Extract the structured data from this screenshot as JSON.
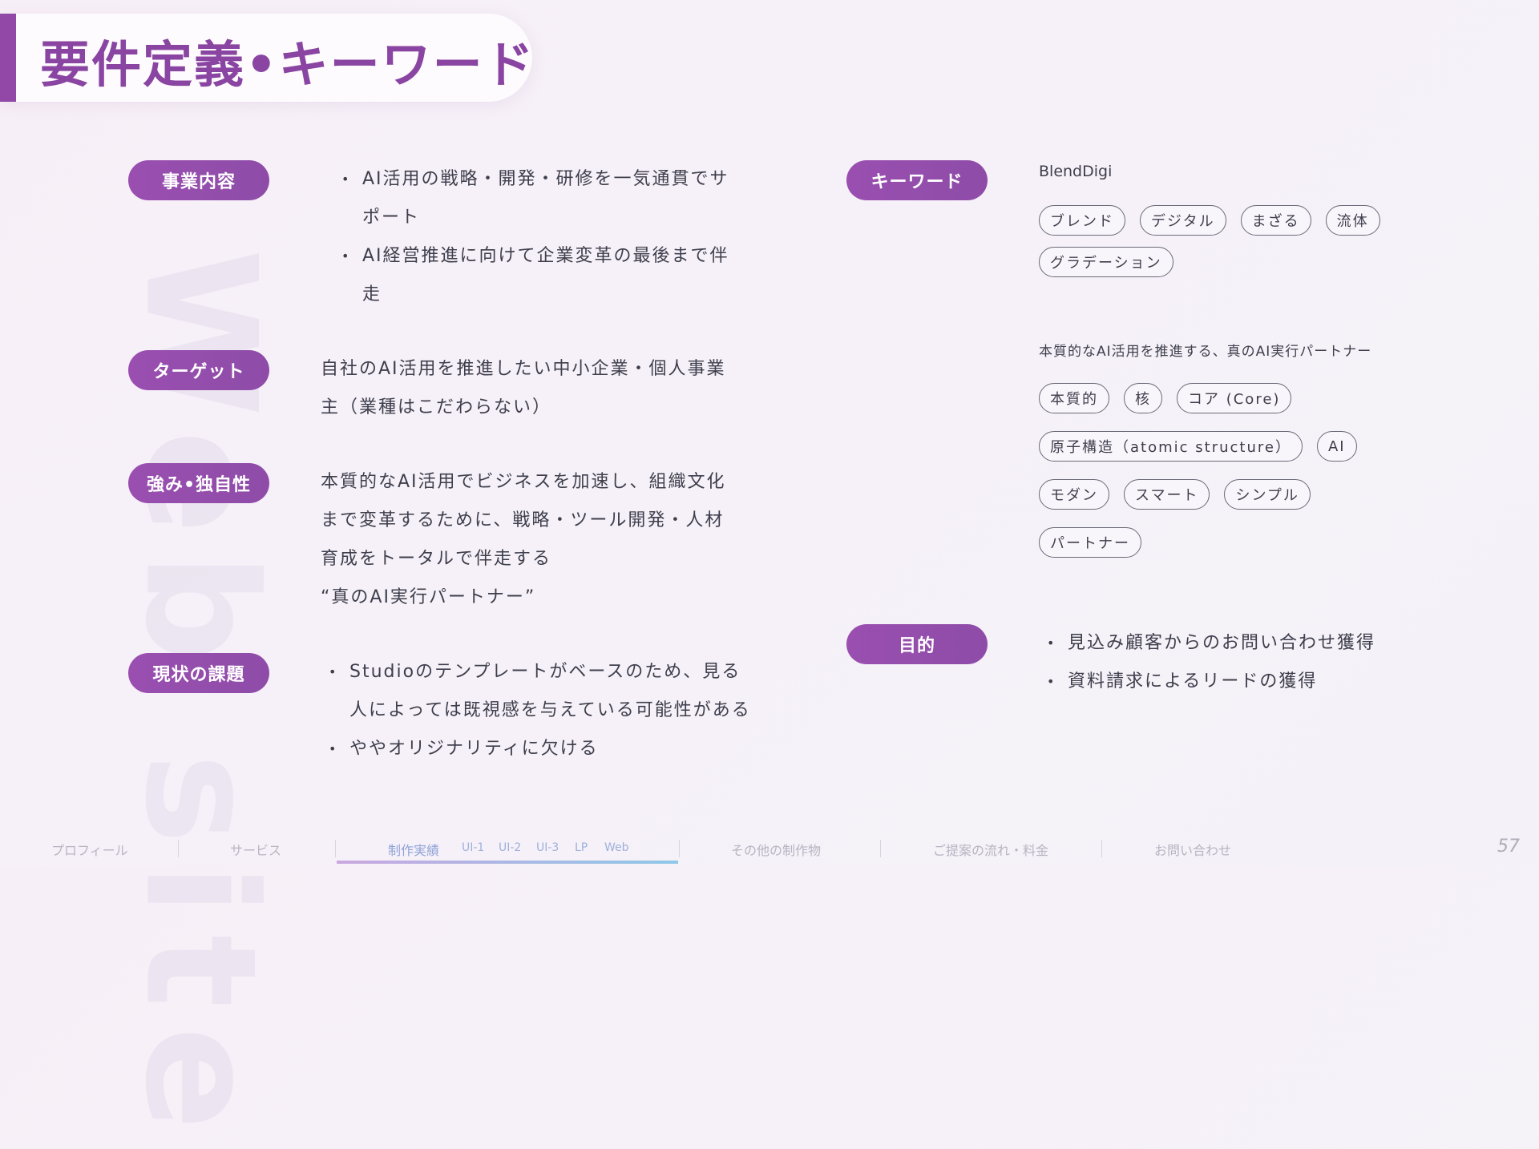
{
  "watermark": "Web site",
  "title": "要件定義•キーワード",
  "sections": {
    "business": {
      "label": "事業内容",
      "items": [
        "AI活用の戦略・開発・研修を一気通貫でサ",
        "ポート",
        "AI経営推進に向けて企業変革の最後まで伴",
        "走"
      ]
    },
    "target": {
      "label": "ターゲット",
      "lines": [
        "自社のAI活用を推進したい中小企業・個人事業",
        "主（業種はこだわらない）"
      ]
    },
    "strength": {
      "label": "強み•独自性",
      "lines": [
        "本質的なAI活用でビジネスを加速し、組織文化",
        "まで変革するために、戦略・ツール開発・人材",
        "育成をトータルで伴走する",
        "“真のAI実行パートナー”"
      ]
    },
    "issues": {
      "label": "現状の課題",
      "items": [
        "Studioのテンプレートがベースのため、見る",
        "人によっては既視感を与えている可能性がある",
        "ややオリジナリティに欠ける"
      ]
    },
    "keywords": {
      "label": "キーワード"
    },
    "purpose": {
      "label": "目的",
      "items": [
        "見込み顧客からのお問い合わせ獲得",
        "資料請求によるリードの獲得"
      ]
    }
  },
  "brand": "BlendDigi",
  "brand_tags": [
    "ブレンド",
    "デジタル",
    "まざる",
    "流体",
    "グラデーション"
  ],
  "tagline": "本質的なAI活用を推進する、真のAI実行パートナー",
  "tagline_tags": [
    "本質的",
    "核",
    "コア (Core)",
    "原子構造（atomic structure）",
    "AI",
    "モダン",
    "スマート",
    "シンプル",
    "パートナー"
  ],
  "footer": {
    "nav": [
      "プロフィール",
      "サービス",
      "制作実績",
      "その他の制作物",
      "ご提案の流れ・料金",
      "お問い合わせ"
    ],
    "sub": [
      "UI-1",
      "UI-2",
      "UI-3",
      "LP",
      "Web"
    ],
    "page_number": "57"
  },
  "colors": {
    "accent": "#9148a6",
    "pill": "#9a4fb0",
    "nav_active": "#8fa3d8"
  }
}
